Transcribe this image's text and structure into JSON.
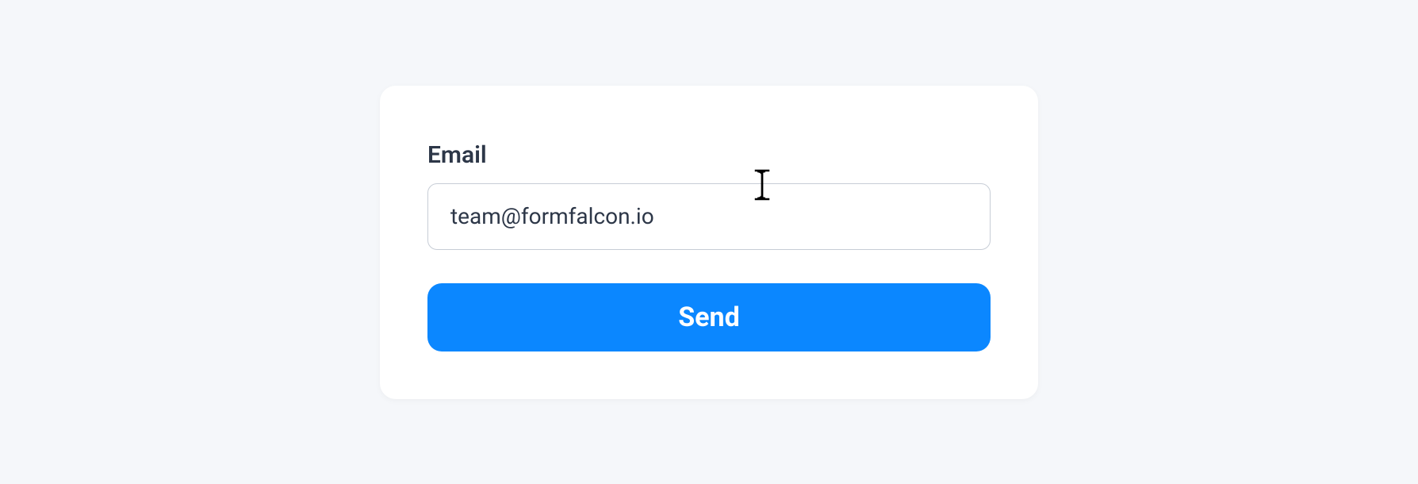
{
  "form": {
    "email_label": "Email",
    "email_value": "team@formfalcon.io",
    "submit_label": "Send"
  },
  "colors": {
    "background": "#f5f7fa",
    "card": "#ffffff",
    "text": "#2d3748",
    "border": "#c7cdd6",
    "button": "#0b87ff",
    "button_text": "#ffffff"
  }
}
